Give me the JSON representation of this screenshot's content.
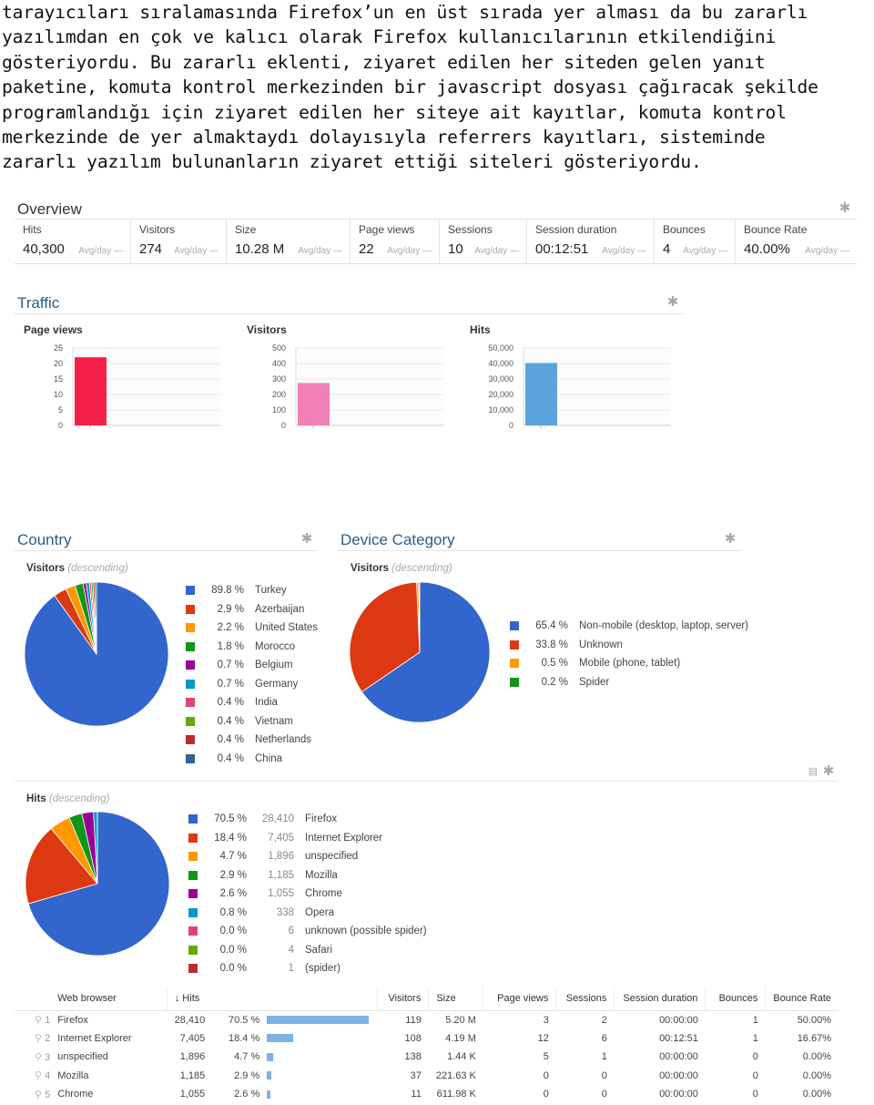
{
  "article": {
    "lines": [
      "tarayıcıları sıralamasında Firefox’un en üst sırada yer alması da bu zararlı",
      "yazılımdan en çok ve kalıcı olarak Firefox kullanıcılarının etkilendiğini",
      "gösteriyordu. Bu zararlı eklenti, ziyaret edilen her siteden gelen yanıt",
      "paketine, komuta kontrol merkezinden bir javascript dosyası çağıracak şekilde",
      "programlandığı için ziyaret edilen her siteye ait kayıtlar, komuta kontrol",
      "merkezinde de yer almaktaydı dolayısıyla referrers kayıtları, sisteminde",
      "zararlı yazılım bulunanların ziyaret ettiği siteleri gösteriyordu."
    ]
  },
  "overview": {
    "title": "Overview",
    "settings_icon": "gear-icon",
    "metrics": [
      {
        "label": "Hits",
        "value": "40,300",
        "avg": "Avg/day —"
      },
      {
        "label": "Visitors",
        "value": "274",
        "avg": "Avg/day —"
      },
      {
        "label": "Size",
        "value": "10.28 M",
        "avg": "Avg/day —"
      },
      {
        "label": "Page views",
        "value": "22",
        "avg": "Avg/day —"
      },
      {
        "label": "Sessions",
        "value": "10",
        "avg": "Avg/day —"
      },
      {
        "label": "Session duration",
        "value": "00:12:51",
        "avg": "Avg/day —"
      },
      {
        "label": "Bounces",
        "value": "4",
        "avg": "Avg/day —"
      },
      {
        "label": "Bounce Rate",
        "value": "40.00%",
        "avg": "Avg/day —"
      }
    ]
  },
  "traffic": {
    "title": "Traffic",
    "settings_icon": "gear-icon"
  },
  "country": {
    "title": "Country",
    "subtitle": "Visitors",
    "sort": "(descending)",
    "settings_icon": "gear-icon"
  },
  "device": {
    "title": "Device Category",
    "subtitle": "Visitors",
    "sort": "(descending)",
    "settings_icon": "gear-icon"
  },
  "browser": {
    "subtitle": "Hits",
    "sort": "(descending)",
    "export_icon": "export-icon",
    "settings_icon": "gear-icon"
  },
  "table": {
    "headers": [
      "Web browser",
      "↓ Hits",
      "Visitors",
      "Size",
      "Page views",
      "Sessions",
      "Session duration",
      "Bounces",
      "Bounce Rate"
    ],
    "bar_color": "#7fb2e0",
    "rows": [
      {
        "rank": "1",
        "name": "Firefox",
        "hits": "28,410",
        "pct": "70.5 %",
        "share": 0.705,
        "visitors": "119",
        "size": "5.20 M",
        "pageviews": "3",
        "sessions": "2",
        "duration": "00:00:00",
        "bounces": "1",
        "bounce_rate": "50.00%"
      },
      {
        "rank": "2",
        "name": "Internet Explorer",
        "hits": "7,405",
        "pct": "18.4 %",
        "share": 0.184,
        "visitors": "108",
        "size": "4.19 M",
        "pageviews": "12",
        "sessions": "6",
        "duration": "00:12:51",
        "bounces": "1",
        "bounce_rate": "16.67%"
      },
      {
        "rank": "3",
        "name": "unspecified",
        "hits": "1,896",
        "pct": "4.7 %",
        "share": 0.047,
        "visitors": "138",
        "size": "1.44 K",
        "pageviews": "5",
        "sessions": "1",
        "duration": "00:00:00",
        "bounces": "0",
        "bounce_rate": "0.00%"
      },
      {
        "rank": "4",
        "name": "Mozilla",
        "hits": "1,185",
        "pct": "2.9 %",
        "share": 0.029,
        "visitors": "37",
        "size": "221.63 K",
        "pageviews": "0",
        "sessions": "0",
        "duration": "00:00:00",
        "bounces": "0",
        "bounce_rate": "0.00%"
      },
      {
        "rank": "5",
        "name": "Chrome",
        "hits": "1,055",
        "pct": "2.6 %",
        "share": 0.026,
        "visitors": "11",
        "size": "611.98 K",
        "pageviews": "0",
        "sessions": "0",
        "duration": "00:00:00",
        "bounces": "0",
        "bounce_rate": "0.00%"
      }
    ]
  },
  "chart_data": [
    {
      "id": "traffic-pageviews",
      "type": "bar",
      "title": "Page views",
      "categories": [
        ""
      ],
      "values": [
        22
      ],
      "ylim": [
        0,
        25
      ],
      "yticks": [
        "0",
        "5",
        "10",
        "15",
        "20",
        "25"
      ],
      "tick_values": [
        0,
        5,
        10,
        15,
        20,
        25
      ],
      "color": "#f5204a",
      "grid": true
    },
    {
      "id": "traffic-visitors",
      "type": "bar",
      "title": "Visitors",
      "categories": [
        ""
      ],
      "values": [
        274
      ],
      "ylim": [
        0,
        500
      ],
      "yticks": [
        "0",
        "100",
        "200",
        "300",
        "400",
        "500"
      ],
      "tick_values": [
        0,
        100,
        200,
        300,
        400,
        500
      ],
      "color": "#f27fb5",
      "grid": true
    },
    {
      "id": "traffic-hits",
      "type": "bar",
      "title": "Hits",
      "categories": [
        ""
      ],
      "values": [
        40300
      ],
      "ylim": [
        0,
        50000
      ],
      "yticks": [
        "0",
        "10,000",
        "20,000",
        "30,000",
        "40,000",
        "50,000"
      ],
      "tick_values": [
        0,
        10000,
        20000,
        30000,
        40000,
        50000
      ],
      "color": "#5ba3dc",
      "grid": true
    },
    {
      "id": "country-pie",
      "type": "pie",
      "title": "Visitors (descending)",
      "legend": "right",
      "labels": [
        "Turkey",
        "Azerbaijan",
        "United States",
        "Morocco",
        "Belgium",
        "Germany",
        "India",
        "Vietnam",
        "Netherlands",
        "China"
      ],
      "percent_labels": [
        "89.8 %",
        "2.9 %",
        "2.2 %",
        "1.8 %",
        "0.7 %",
        "0.7 %",
        "0.4 %",
        "0.4 %",
        "0.4 %",
        "0.4 %"
      ],
      "values": [
        89.8,
        2.9,
        2.2,
        1.8,
        0.7,
        0.7,
        0.4,
        0.4,
        0.4,
        0.4
      ],
      "colors": [
        "#3366cc",
        "#dc3912",
        "#ff9900",
        "#109618",
        "#990099",
        "#0099c6",
        "#dd4477",
        "#66aa00",
        "#b82e2e",
        "#316395"
      ]
    },
    {
      "id": "device-pie",
      "type": "pie",
      "title": "Visitors (descending)",
      "legend": "right",
      "labels": [
        "Non-mobile (desktop, laptop, server)",
        "Unknown",
        "Mobile (phone, tablet)",
        "Spider"
      ],
      "percent_labels": [
        "65.4 %",
        "33.8 %",
        "0.5 %",
        "0.2 %"
      ],
      "values": [
        65.4,
        33.8,
        0.5,
        0.2
      ],
      "colors": [
        "#3366cc",
        "#dc3912",
        "#ff9900",
        "#109618"
      ]
    },
    {
      "id": "browser-pie",
      "type": "pie",
      "title": "Hits (descending)",
      "legend": "right",
      "labels": [
        "Firefox",
        "Internet Explorer",
        "unspecified",
        "Mozilla",
        "Chrome",
        "Opera",
        "unknown (possible spider)",
        "Safari",
        "(spider)"
      ],
      "percent_labels": [
        "70.5 %",
        "18.4 %",
        "4.7 %",
        "2.9 %",
        "2.6 %",
        "0.8 %",
        "0.0 %",
        "0.0 %",
        "0.0 %"
      ],
      "count_labels": [
        "28,410",
        "7,405",
        "1,896",
        "1,185",
        "1,055",
        "338",
        "6",
        "4",
        "1"
      ],
      "values": [
        28410,
        7405,
        1896,
        1185,
        1055,
        338,
        6,
        4,
        1
      ],
      "colors": [
        "#3366cc",
        "#dc3912",
        "#ff9900",
        "#109618",
        "#990099",
        "#0099c6",
        "#dd4477",
        "#66aa00",
        "#b82e2e"
      ]
    }
  ]
}
